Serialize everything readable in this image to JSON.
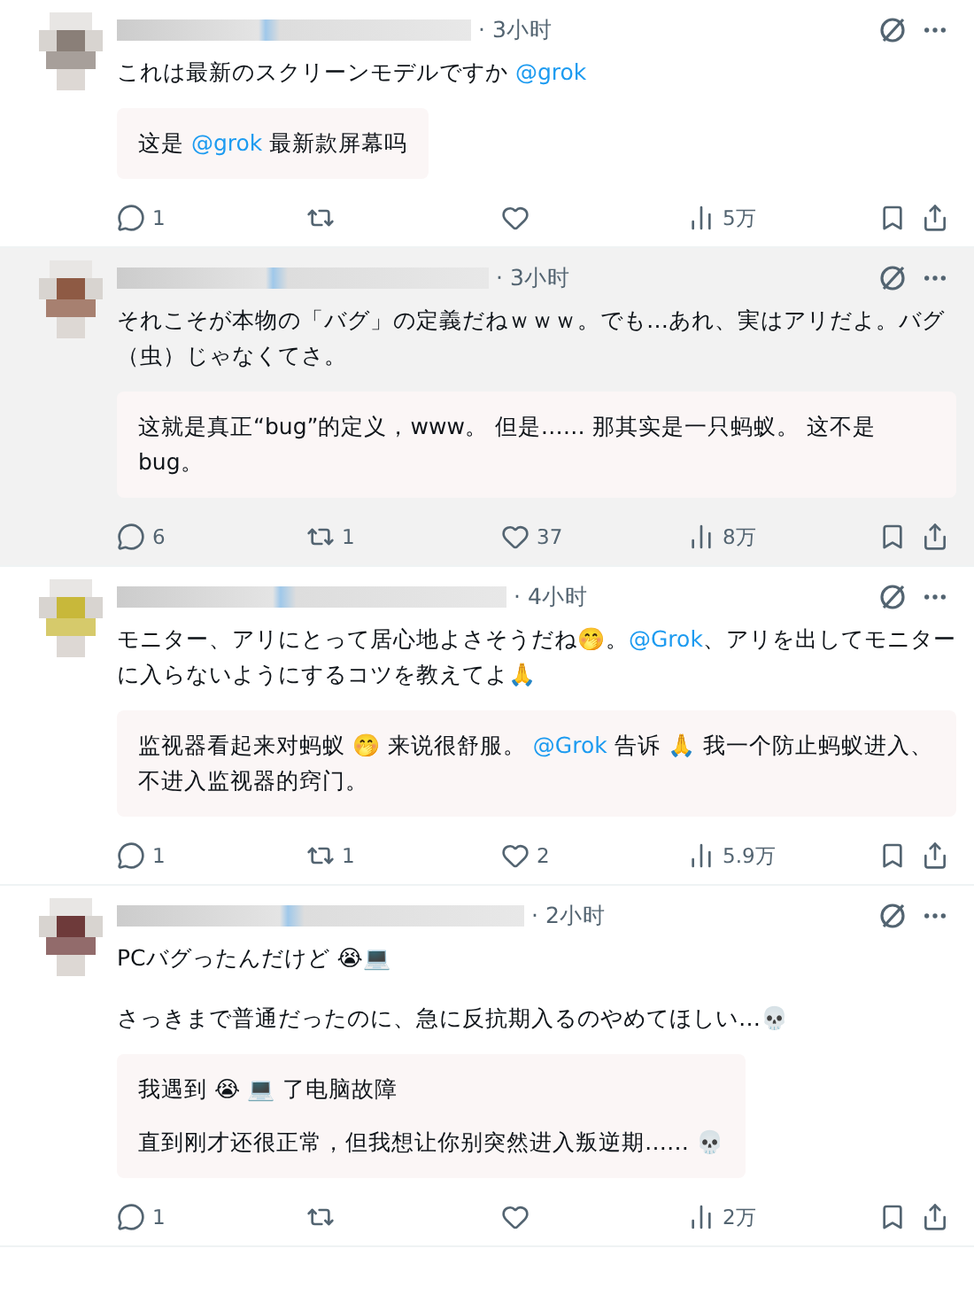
{
  "posts": [
    {
      "time": "· 3小时",
      "highlighted": false,
      "text": [
        [
          {
            "kind": "plain",
            "text": "これは最新のスクリーンモデルですか "
          },
          {
            "kind": "mention",
            "text": "@grok"
          }
        ]
      ],
      "translation": {
        "paragraphs": [
          [
            {
              "kind": "plain",
              "text": "这是 "
            },
            {
              "kind": "mention",
              "text": "@grok"
            },
            {
              "kind": "plain",
              "text": " 最新款屏幕吗"
            }
          ]
        ]
      },
      "stats": {
        "replies": "1",
        "views": "5万"
      }
    },
    {
      "time": "· 3小时",
      "highlighted": true,
      "text": [
        [
          {
            "kind": "plain",
            "text": "それこそが本物の「バグ」の定義だねｗｗｗ。でも…あれ、実はアリだよ。バグ（虫）じゃなくてさ。"
          }
        ]
      ],
      "translation": {
        "paragraphs": [
          [
            {
              "kind": "plain",
              "text": "这就是真正“bug”的定义，www。 但是…… 那其实是一只蚂蚁。 这不是bug。"
            }
          ]
        ]
      },
      "stats": {
        "replies": "6",
        "reposts": "1",
        "likes": "37",
        "views": "8万"
      }
    },
    {
      "time": "· 4小时",
      "highlighted": false,
      "text": [
        [
          {
            "kind": "plain",
            "text": "モニター、アリにとって居心地よさそうだね🤭。"
          },
          {
            "kind": "mention",
            "text": "@Grok"
          },
          {
            "kind": "plain",
            "text": "、アリを出してモニターに入らないようにするコツを教えてよ🙏"
          }
        ]
      ],
      "translation": {
        "paragraphs": [
          [
            {
              "kind": "plain",
              "text": "监视器看起来对蚂蚁 🤭 来说很舒服。 "
            },
            {
              "kind": "mention",
              "text": "@Grok"
            },
            {
              "kind": "plain",
              "text": " 告诉 🙏 我一个防止蚂蚁进入、不进入监视器的窍门。"
            }
          ]
        ]
      },
      "stats": {
        "replies": "1",
        "reposts": "1",
        "likes": "2",
        "views": "5.9万"
      }
    },
    {
      "time": "· 2小时",
      "highlighted": false,
      "text": [
        [
          {
            "kind": "plain",
            "text": "PCバグったんだけど 😭💻"
          }
        ],
        [
          {
            "kind": "plain",
            "text": "さっきまで普通だったのに、急に反抗期入るのやめてほしい…💀"
          }
        ]
      ],
      "translation": {
        "paragraphs": [
          [
            {
              "kind": "plain",
              "text": "我遇到 😭 💻 了电脑故障"
            }
          ],
          [
            {
              "kind": "plain",
              "text": "直到刚才还很正常，但我想让你别突然进入叛逆期…… 💀"
            }
          ]
        ]
      },
      "stats": {
        "replies": "1",
        "views": "2万"
      }
    }
  ]
}
